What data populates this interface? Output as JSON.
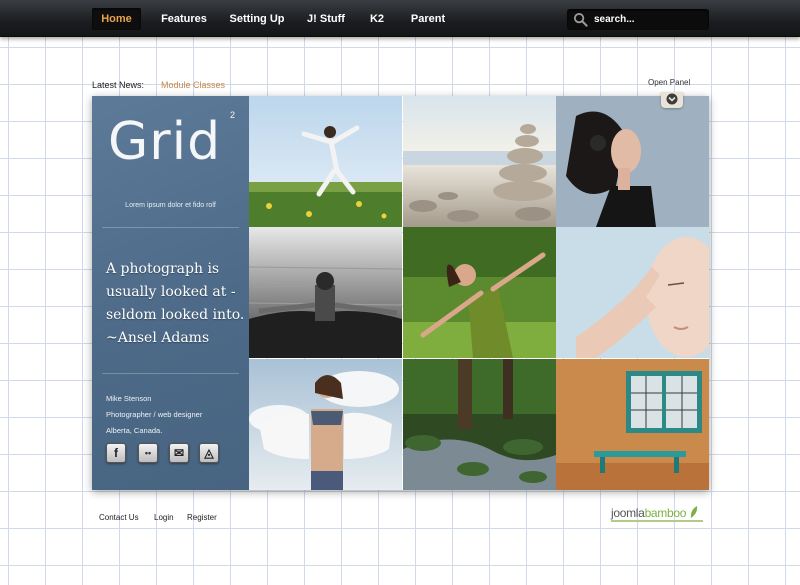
{
  "nav": {
    "items": [
      {
        "label": "Home",
        "active": true
      },
      {
        "label": "Features"
      },
      {
        "label": "Setting Up"
      },
      {
        "label": "J! Stuff"
      },
      {
        "label": "K2"
      },
      {
        "label": "Parent"
      }
    ],
    "search_placeholder": "search...",
    "search_icon": "magnifier-icon"
  },
  "news": {
    "label": "Latest News:",
    "link": "Module Classes"
  },
  "panel": {
    "open_label": "Open Panel",
    "toggle_icon": "chevron-down-icon"
  },
  "sidebar": {
    "logo_text": "Grid",
    "logo_superscript": "2",
    "tagline": "Lorem ipsum dolor et fido rolf",
    "quote": "A photograph is usually looked at - seldom looked into. ~Ansel Adams",
    "author": {
      "name": "Mike Stenson",
      "role": "Photographer / web designer",
      "location": "Alberta, Canada."
    },
    "social": [
      {
        "name": "facebook-icon",
        "glyph": "f"
      },
      {
        "name": "flickr-icon",
        "glyph": "••"
      },
      {
        "name": "mail-icon",
        "glyph": "✉"
      },
      {
        "name": "feed-icon",
        "glyph": "◬"
      }
    ]
  },
  "gallery": [
    {
      "subject": "woman-dancing-meadow"
    },
    {
      "subject": "stacked-stones-beach"
    },
    {
      "subject": "woman-with-headphones"
    },
    {
      "subject": "woman-in-water"
    },
    {
      "subject": "woman-arms-open-grass"
    },
    {
      "subject": "woman-hand-on-face"
    },
    {
      "subject": "woman-white-shirt-sky"
    },
    {
      "subject": "forest-stream"
    },
    {
      "subject": "orange-wall-window-bench"
    }
  ],
  "footer": {
    "links": [
      "Contact Us",
      "Login",
      "Register"
    ],
    "brand_prefix": "joomla",
    "brand_suffix": "bamboo"
  },
  "colors": {
    "nav_active": "#e8a34a",
    "news_link": "#c8874a",
    "sidebar_blue": "#526f8d",
    "brand_green": "#7bb043"
  }
}
